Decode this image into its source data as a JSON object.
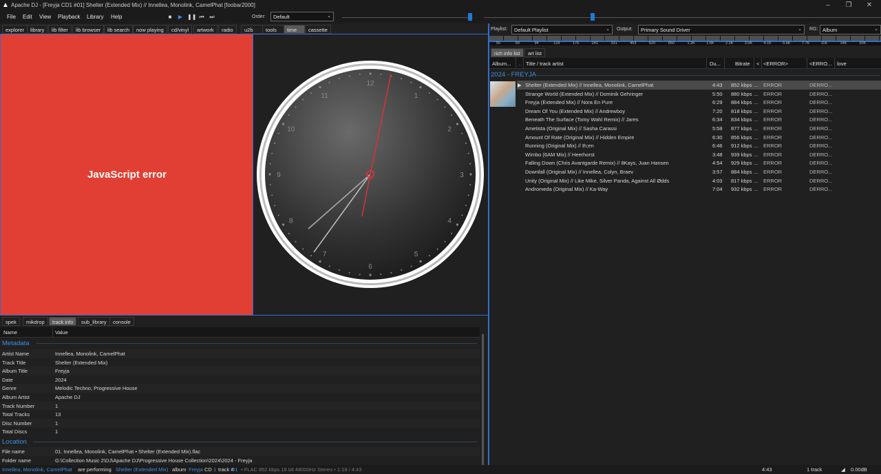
{
  "window": {
    "title": "Apache DJ - [Freyja CD1 #01] Shelter (Extended Mix) // Innellea, Monolink, CamelPhat  [foobar2000]"
  },
  "menu": [
    "File",
    "Edit",
    "View",
    "Playback",
    "Library",
    "Help"
  ],
  "toolbar": {
    "order_label": "Order:",
    "order_value": "Default",
    "playlist_label": "Playlist:",
    "playlist_value": "Default Playlist",
    "output_label": "Output:",
    "output_value": "Primary Sound Driver",
    "rg_label": "RG:",
    "rg_value": "Album"
  },
  "top_tabs": [
    {
      "label": "explorer",
      "active": false
    },
    {
      "label": "library",
      "active": false
    },
    {
      "label": "lib filter",
      "active": false
    },
    {
      "label": "lib browser",
      "active": false
    },
    {
      "label": "lib search",
      "active": false
    },
    {
      "label": "now playing",
      "active": false
    },
    {
      "label": "cd/vinyl",
      "active": false
    },
    {
      "label": "artwork",
      "active": false
    },
    {
      "label": "radio",
      "active": false
    },
    {
      "label": "u2b",
      "active": false
    },
    {
      "label": "tools",
      "active": false
    },
    {
      "label": "time",
      "active": true
    },
    {
      "label": "cassette",
      "active": false
    }
  ],
  "js_error_text": "JavaScript error",
  "clock": {
    "numbers": [
      "12",
      "1",
      "2",
      "3",
      "4",
      "5",
      "6",
      "7",
      "8",
      "9",
      "10",
      "11"
    ]
  },
  "bottom_tabs": [
    {
      "label": "spek",
      "active": false
    },
    {
      "label": "mikdrop",
      "active": false
    },
    {
      "label": "track info",
      "active": true
    },
    {
      "label": "sub_library",
      "active": false
    },
    {
      "label": "console",
      "active": false
    }
  ],
  "props": {
    "col_name": "Name",
    "col_value": "Value",
    "metadata_title": "Metadata",
    "metadata": [
      {
        "name": "Artist Name",
        "value": "Innellea, Monolink, CamelPhat"
      },
      {
        "name": "Track Title",
        "value": "Shelter (Extended Mix)"
      },
      {
        "name": "Album Title",
        "value": "Freyja"
      },
      {
        "name": "Date",
        "value": "2024"
      },
      {
        "name": "Genre",
        "value": "Melodic Techno, Progressive House"
      },
      {
        "name": "Album Artist",
        "value": "Apache DJ"
      },
      {
        "name": "Track Number",
        "value": "1"
      },
      {
        "name": "Total Tracks",
        "value": "13"
      },
      {
        "name": "Disc Number",
        "value": "1"
      },
      {
        "name": "Total Discs",
        "value": "1"
      }
    ],
    "location_title": "Location",
    "location": [
      {
        "name": "File name",
        "value": "01. Innellea, Monolink, CamelPhat • Shelter (Extended Mix).flac"
      },
      {
        "name": "Folder name",
        "value": "G:\\Collection Music 2\\DJ\\Apache DJ\\Progressive House Collection\\2024\\2024 - Freyja"
      }
    ]
  },
  "spectrum_labels": [
    "50",
    "69",
    "94",
    "129",
    "176",
    "241",
    "331",
    "453",
    "620",
    "850",
    "1.2K",
    "1.6K",
    "2.2K",
    "3.0K",
    "4.1K",
    "5.6K",
    "7.7K",
    "11K",
    "14K",
    "20K"
  ],
  "right_tabs": [
    {
      "label": "rich info list",
      "active": true
    },
    {
      "label": "art list",
      "active": false
    }
  ],
  "playlist": {
    "columns": [
      "Album...",
      ".",
      "Title / track artist",
      "Du...",
      "Bitrate",
      "<",
      "<ERROR>",
      "<ERRO...",
      "love"
    ],
    "album_heading": "2024 - FREYJA",
    "tracks": [
      {
        "title": "Shelter (Extended Mix) // Innellea, Monolink, CamelPhat",
        "dur": "4:43",
        "bitrate": "852 kbps",
        "e1": "ERROR",
        "e2": "DERRO...",
        "selected": true
      },
      {
        "title": "Strange World (Extended Mix) // Dominik Gehringer",
        "dur": "5:50",
        "bitrate": "880 kbps",
        "e1": "ERROR",
        "e2": "DERRO...",
        "selected": false
      },
      {
        "title": "Freyja (Extended Mix) // Nora En Pure",
        "dur": "6:29",
        "bitrate": "884 kbps",
        "e1": "ERROR",
        "e2": "DERRO...",
        "selected": false
      },
      {
        "title": "Dream Of You (Extended Mix) // Andrewboy",
        "dur": "7:20",
        "bitrate": "818 kbps",
        "e1": "ERROR",
        "e2": "DERRO...",
        "selected": false
      },
      {
        "title": "Beneath The Surface (Tomy Wahl Remix) // Jares",
        "dur": "6:34",
        "bitrate": "834 kbps",
        "e1": "ERROR",
        "e2": "DERRO...",
        "selected": false
      },
      {
        "title": "Ametista (Original Mix) // Sasha Carassi",
        "dur": "5:58",
        "bitrate": "877 kbps",
        "e1": "ERROR",
        "e2": "DERRO...",
        "selected": false
      },
      {
        "title": "Amount Of Rate (Original Mix) // Hidden Empire",
        "dur": "6:30",
        "bitrate": "856 kbps",
        "e1": "ERROR",
        "e2": "DERRO...",
        "selected": false
      },
      {
        "title": "Running (Original Mix) // th;en",
        "dur": "6:46",
        "bitrate": "912 kbps",
        "e1": "ERROR",
        "e2": "DERRO...",
        "selected": false
      },
      {
        "title": "Wimbo (6AM Mix) // Heerhorst",
        "dur": "3:48",
        "bitrate": "939 kbps",
        "e1": "ERROR",
        "e2": "DERRO...",
        "selected": false
      },
      {
        "title": "Falling Down (Chris Avantgarde Remix) // 8Kays, Juan Hansen",
        "dur": "4:54",
        "bitrate": "929 kbps",
        "e1": "ERROR",
        "e2": "DERRO...",
        "selected": false
      },
      {
        "title": "Downfall (Original Mix) // Innellea, Colyn, Braev",
        "dur": "3:57",
        "bitrate": "884 kbps",
        "e1": "ERROR",
        "e2": "DERRO...",
        "selected": false
      },
      {
        "title": "Unity (Original Mix) // Like Mike, Silver Panda, Against All Ødds",
        "dur": "4:03",
        "bitrate": "817 kbps",
        "e1": "ERROR",
        "e2": "DERRO...",
        "selected": false
      },
      {
        "title": "Andromeda (Original Mix) // Ka-Way",
        "dur": "7:04",
        "bitrate": "932 kbps",
        "e1": "ERROR",
        "e2": "DERRO...",
        "selected": false
      }
    ]
  },
  "status": {
    "artist": "Innellea, Monolink, CamelPhat",
    "are_performing": "are performing",
    "track": "Shelter (Extended Mix)",
    "album_word": "album",
    "album": "Freyja",
    "cd": "CD",
    "cd_num": "1",
    "track_word": "track #",
    "track_num": "01",
    "tech": "•  FLAC 852 kbps 16 bit 48000Hz Stereo • 1:18 / 4:43",
    "length": "4:43",
    "count": "1 track",
    "volume": "0.00dB"
  },
  "colors": {
    "accent": "#2f6fd0",
    "error_panel": "#e13f33",
    "text_blue": "#3f8fe0"
  }
}
